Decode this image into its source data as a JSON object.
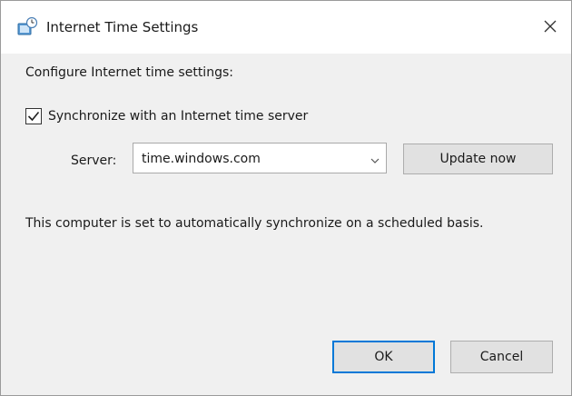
{
  "window": {
    "title": "Internet Time Settings",
    "title_icon": "clock-globe-icon",
    "close_icon": "close-icon"
  },
  "content": {
    "heading": "Configure Internet time settings:",
    "sync_checkbox": {
      "label": "Synchronize with an Internet time server",
      "checked": true
    },
    "server": {
      "label": "Server:",
      "value": "time.windows.com",
      "dropdown_icon": "chevron-down-icon"
    },
    "update_button": "Update now",
    "description": "This computer is set to automatically synchronize on a scheduled basis."
  },
  "footer": {
    "ok_label": "OK",
    "cancel_label": "Cancel"
  },
  "colors": {
    "accent": "#0078d7",
    "button_face": "#e1e1e1",
    "dialog_bg": "#f0f0f0"
  }
}
